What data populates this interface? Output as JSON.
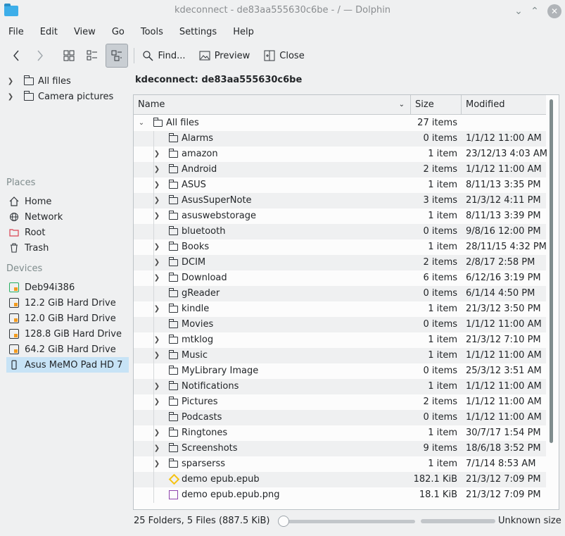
{
  "window": {
    "title": "kdeconnect - de83aa555630c6be - / — Dolphin",
    "minimize_glyph": "⌄",
    "maximize_glyph": "⌃",
    "close_glyph": "✕"
  },
  "menu": [
    "File",
    "Edit",
    "View",
    "Go",
    "Tools",
    "Settings",
    "Help"
  ],
  "toolbar": {
    "find_label": "Find...",
    "preview_label": "Preview",
    "close_label": "Close"
  },
  "folders_panel": {
    "items": [
      {
        "label": "All files"
      },
      {
        "label": "Camera pictures"
      }
    ]
  },
  "places": {
    "title": "Places",
    "items": [
      {
        "label": "Home",
        "icon": "home-icon"
      },
      {
        "label": "Network",
        "icon": "network-icon"
      },
      {
        "label": "Root",
        "icon": "root-icon"
      },
      {
        "label": "Trash",
        "icon": "trash-icon"
      }
    ]
  },
  "devices": {
    "title": "Devices",
    "items": [
      {
        "label": "Deb94i386"
      },
      {
        "label": "12.2 GiB Hard Drive"
      },
      {
        "label": "12.0 GiB Hard Drive"
      },
      {
        "label": "128.8 GiB Hard Drive"
      },
      {
        "label": "64.2 GiB Hard Drive"
      },
      {
        "label": "Asus MeMO Pad HD 7"
      }
    ]
  },
  "location": "kdeconnect: de83aa555630c6be",
  "columns": {
    "name": "Name",
    "size": "Size",
    "modified": "Modified"
  },
  "root_row": {
    "name": "All files",
    "size": "27 items",
    "modified": ""
  },
  "rows": [
    {
      "name": "Alarms",
      "size": "0 items",
      "modified": "1/1/12 11:00 AM",
      "expandable": false,
      "type": "folder"
    },
    {
      "name": "amazon",
      "size": "1 item",
      "modified": "23/12/13 4:03 AM",
      "expandable": true,
      "type": "folder"
    },
    {
      "name": "Android",
      "size": "2 items",
      "modified": "1/1/12 11:00 AM",
      "expandable": true,
      "type": "folder"
    },
    {
      "name": "ASUS",
      "size": "1 item",
      "modified": "8/11/13 3:35 PM",
      "expandable": true,
      "type": "folder"
    },
    {
      "name": "AsusSuperNote",
      "size": "3 items",
      "modified": "21/3/12 4:11 PM",
      "expandable": true,
      "type": "folder"
    },
    {
      "name": "asuswebstorage",
      "size": "1 item",
      "modified": "8/11/13 3:39 PM",
      "expandable": true,
      "type": "folder"
    },
    {
      "name": "bluetooth",
      "size": "0 items",
      "modified": "9/8/16 12:00 PM",
      "expandable": false,
      "type": "folder"
    },
    {
      "name": "Books",
      "size": "1 item",
      "modified": "28/11/15 4:32 PM",
      "expandable": true,
      "type": "folder"
    },
    {
      "name": "DCIM",
      "size": "2 items",
      "modified": "2/8/17 2:58 PM",
      "expandable": true,
      "type": "folder"
    },
    {
      "name": "Download",
      "size": "6 items",
      "modified": "6/12/16 3:19 PM",
      "expandable": true,
      "type": "folder"
    },
    {
      "name": "gReader",
      "size": "0 items",
      "modified": "6/1/14 4:50 PM",
      "expandable": false,
      "type": "folder"
    },
    {
      "name": "kindle",
      "size": "1 item",
      "modified": "21/3/12 3:50 PM",
      "expandable": true,
      "type": "folder"
    },
    {
      "name": "Movies",
      "size": "0 items",
      "modified": "1/1/12 11:00 AM",
      "expandable": false,
      "type": "folder"
    },
    {
      "name": "mtklog",
      "size": "1 item",
      "modified": "21/3/12 7:10 PM",
      "expandable": true,
      "type": "folder"
    },
    {
      "name": "Music",
      "size": "1 item",
      "modified": "1/1/12 11:00 AM",
      "expandable": true,
      "type": "folder"
    },
    {
      "name": "MyLibrary Image",
      "size": "0 items",
      "modified": "25/3/12 3:51 AM",
      "expandable": false,
      "type": "folder"
    },
    {
      "name": "Notifications",
      "size": "1 item",
      "modified": "1/1/12 11:00 AM",
      "expandable": true,
      "type": "folder"
    },
    {
      "name": "Pictures",
      "size": "2 items",
      "modified": "1/1/12 11:00 AM",
      "expandable": true,
      "type": "folder"
    },
    {
      "name": "Podcasts",
      "size": "0 items",
      "modified": "1/1/12 11:00 AM",
      "expandable": false,
      "type": "folder"
    },
    {
      "name": "Ringtones",
      "size": "1 item",
      "modified": "30/7/17 1:54 PM",
      "expandable": true,
      "type": "folder"
    },
    {
      "name": "Screenshots",
      "size": "9 items",
      "modified": "18/6/18 3:52 PM",
      "expandable": true,
      "type": "folder"
    },
    {
      "name": "sparserss",
      "size": "1 item",
      "modified": "7/1/14 8:53 AM",
      "expandable": true,
      "type": "folder"
    },
    {
      "name": "demo epub.epub",
      "size": "182.1 KiB",
      "modified": "21/3/12 7:09 PM",
      "expandable": false,
      "type": "epub"
    },
    {
      "name": "demo epub.epub.png",
      "size": "18.1 KiB",
      "modified": "21/3/12 7:09 PM",
      "expandable": false,
      "type": "png"
    }
  ],
  "status": {
    "summary": "25 Folders, 5 Files (887.5 KiB)",
    "space_label": "Unknown size"
  }
}
